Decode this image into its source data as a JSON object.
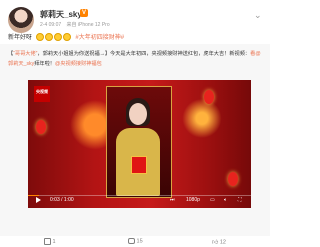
{
  "post": {
    "username": "郭莉天_sky",
    "time": "2-4 09:07",
    "source": "来自 iPhone 12 Pro",
    "text_prefix": "新年好呀",
    "hashtag": "#大年初四接财神#",
    "repost_line1": "【",
    "repost_emphasis": "“哥哥大佬”",
    "repost_mid": "，郭莉天小姐姐为你送祝福→】今天是大年初四，央视频接财神送红包，虎年大吉！新视频：",
    "repost_link": "看",
    "repost_user": "@郭莉天_sky",
    "repost_tail": "拜年啦！",
    "repost_link2": "@央视频接财神福包",
    "tv_logo": "央视频"
  },
  "video": {
    "current_time": "0:03",
    "duration": "1:00",
    "quality": "1080p",
    "progress": 0.05
  },
  "footer": {
    "share_count": "1",
    "comment_count": "15",
    "like_count": "12"
  }
}
